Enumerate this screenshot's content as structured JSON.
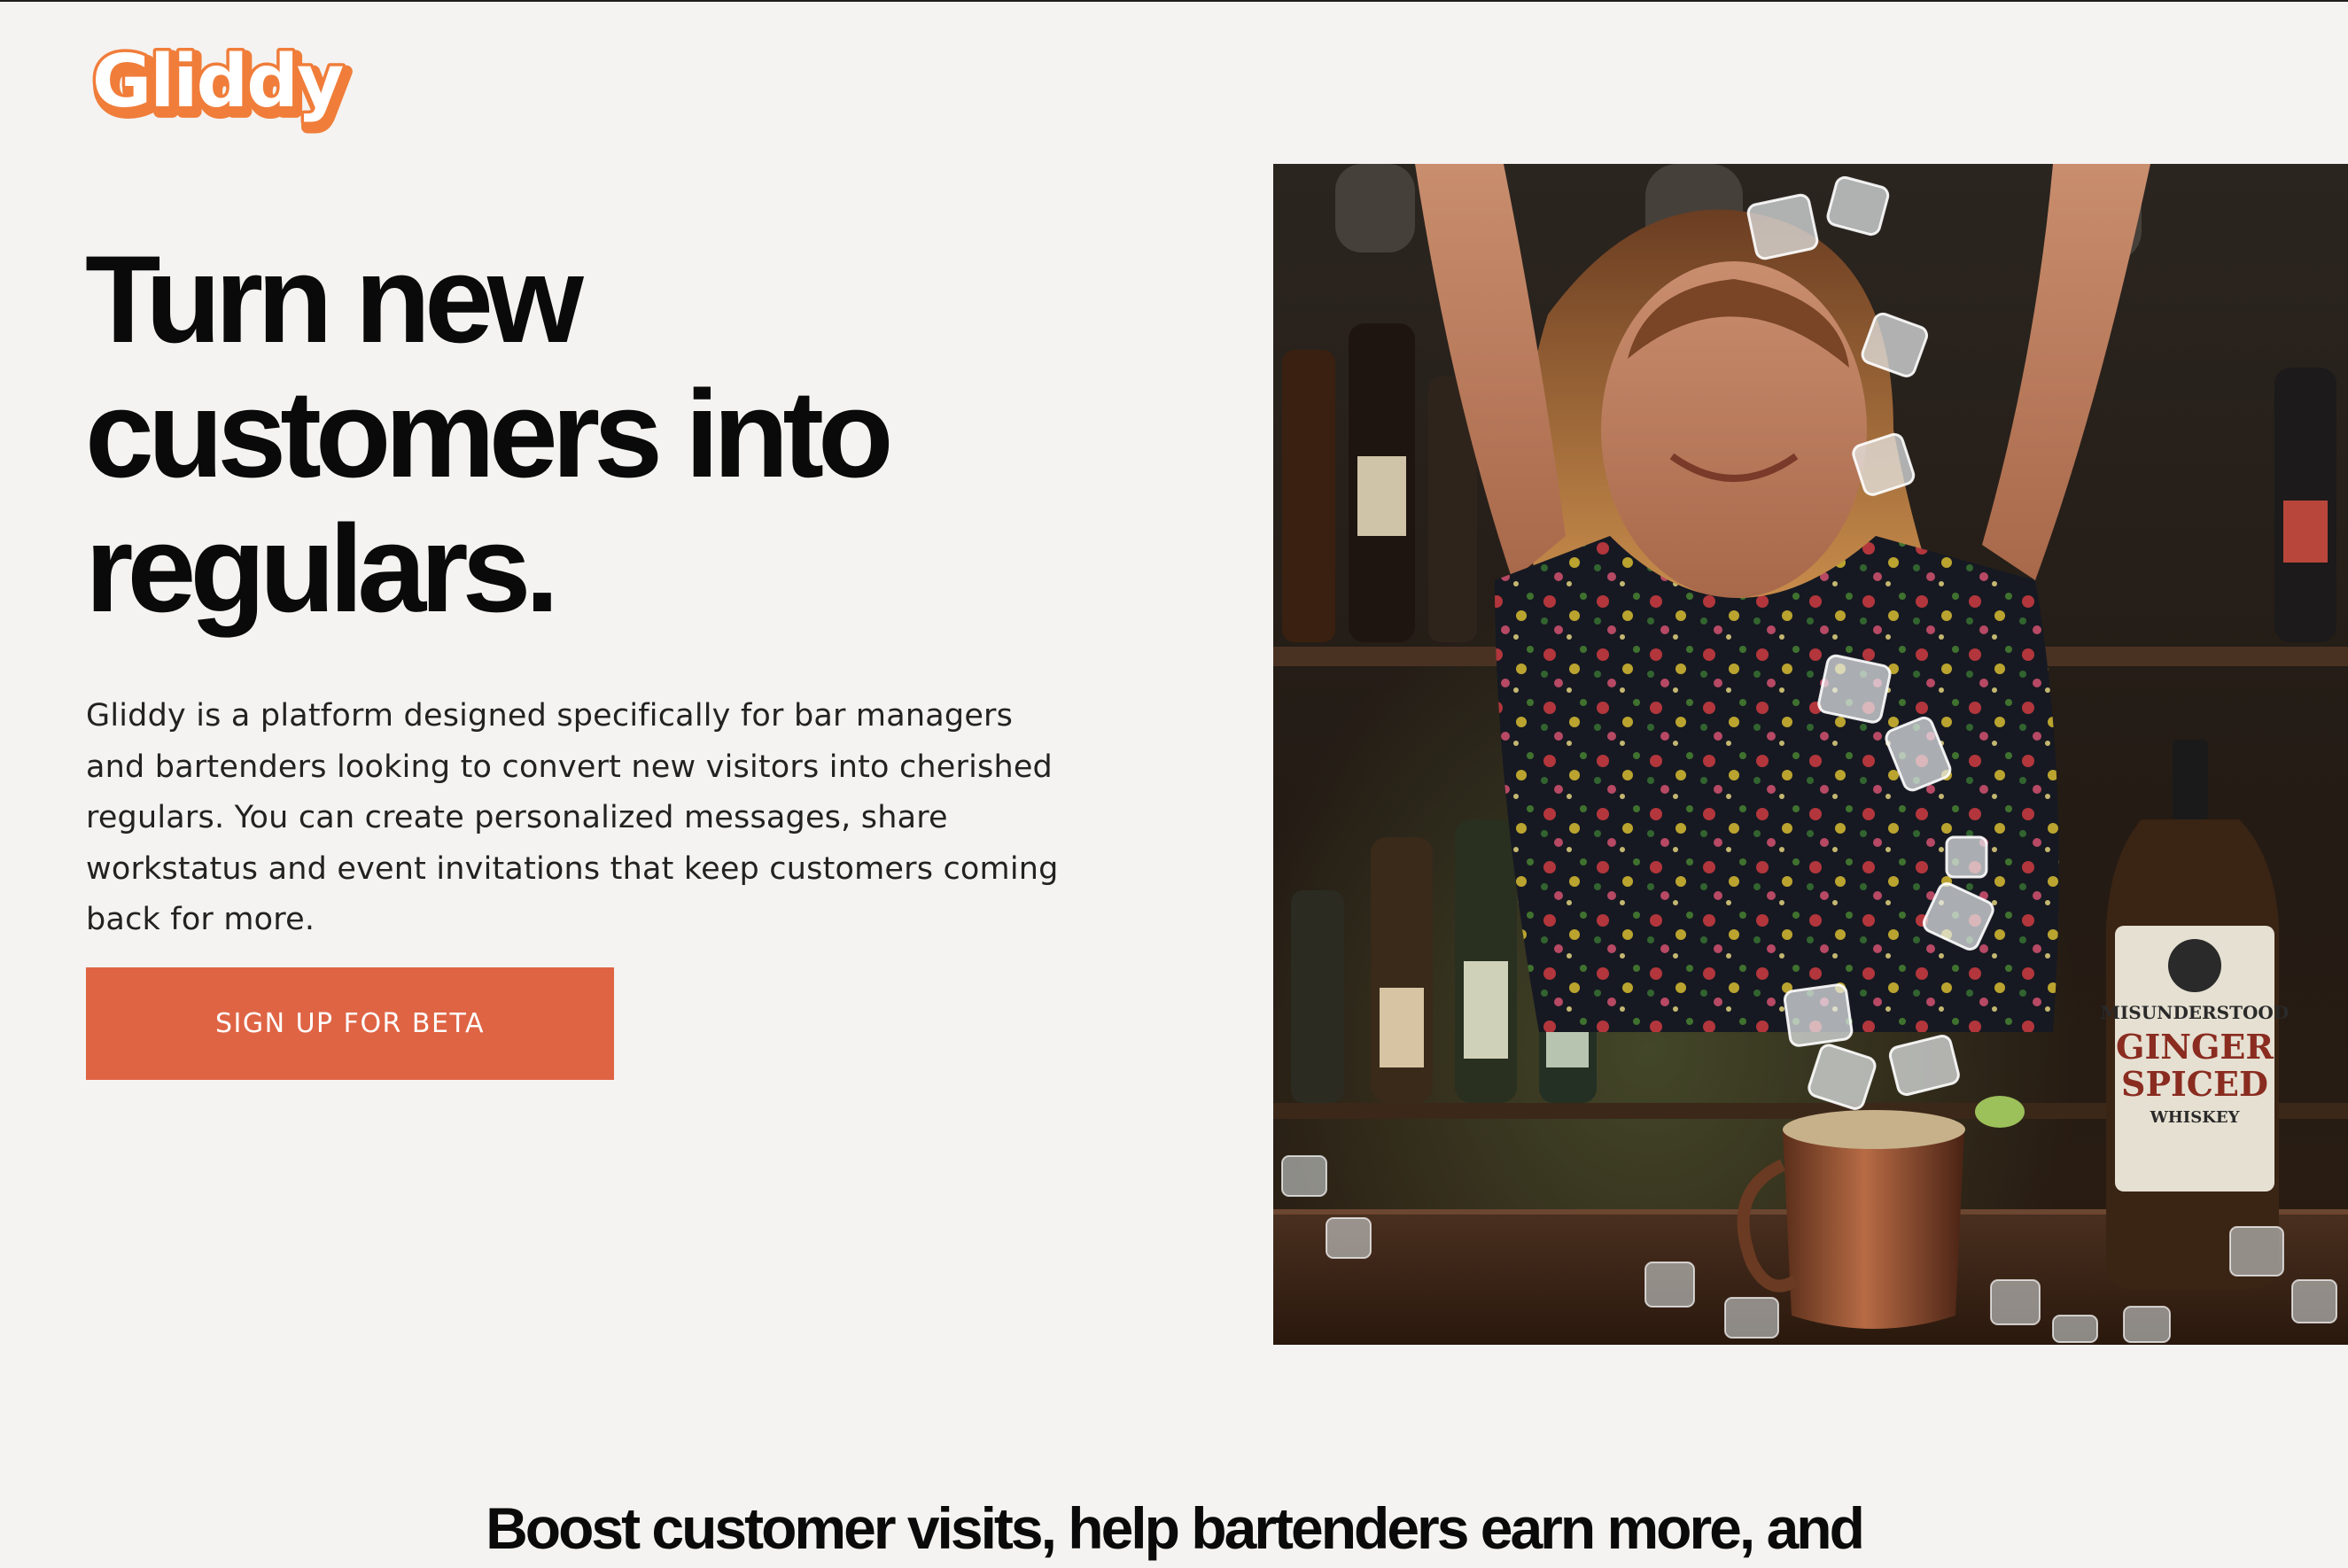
{
  "brand": {
    "name": "Gliddy",
    "accent_color": "#df6444",
    "logo_color": "#f07d3a"
  },
  "hero": {
    "headline_lines": [
      "Turn new",
      "customers into",
      "regulars."
    ],
    "body": "Gliddy is a platform designed specifically for bar managers and bartenders looking to convert new visitors into cherished regulars. You can create personalized messages, share workstatus and event invitations that keep customers coming back for more.",
    "cta_label": "SIGN UP FOR BETA",
    "image": {
      "bottle_label_lines": [
        "MISUNDERSTOOD",
        "GINGER",
        "SPICED",
        "WHISKEY"
      ],
      "icon": "bartender-photo"
    }
  },
  "next_section": {
    "heading": "Boost customer visits, help bartenders earn more, and"
  }
}
